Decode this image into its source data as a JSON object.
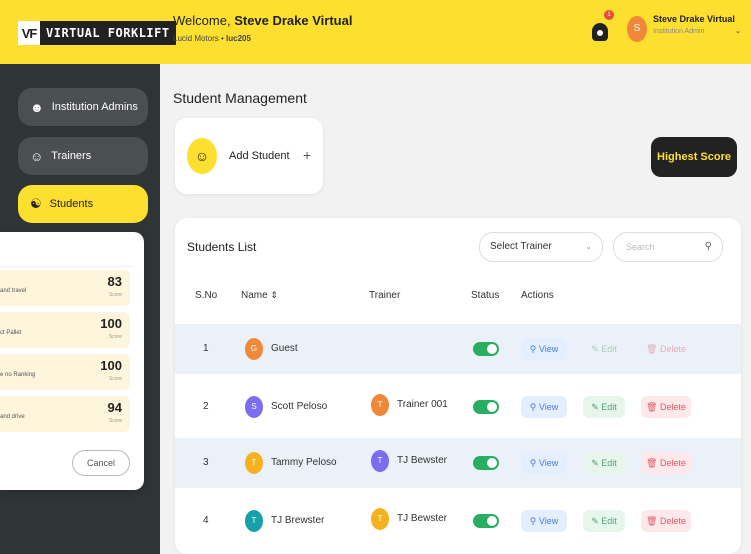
{
  "brand": {
    "logo_mark": "VF",
    "logo_text": "VIRTUAL FORKLIFT"
  },
  "header": {
    "welcome_prefix": "Welcome,",
    "user_full": "Steve Drake Virtual",
    "company": "Lucid Motors",
    "company_sep": " • ",
    "company_code": "luc205",
    "notification_count": "1",
    "avatar_initial": "S",
    "user_name": "Steve Drake Virtual",
    "user_role": "Institution Admin"
  },
  "sidebar": {
    "items": [
      {
        "label": "Institution Admins",
        "icon": "admin-icon"
      },
      {
        "label": "Trainers",
        "icon": "trainer-icon"
      },
      {
        "label": "Students",
        "icon": "student-icon",
        "active": true
      }
    ]
  },
  "main": {
    "title": "Student Management",
    "add_student_label": "Add Student",
    "add_plus": "+",
    "highest_score_label": "Highest Score"
  },
  "list": {
    "title": "Students List",
    "select_trainer": "Select Trainer",
    "search_placeholder": "Search",
    "columns": {
      "sno": "S.No",
      "name": "Name",
      "trainer": "Trainer",
      "status": "Status",
      "actions": "Actions"
    },
    "actions": {
      "view": "View",
      "edit": "Edit",
      "delete": "Delete"
    },
    "rows": [
      {
        "sno": "1",
        "initial": "G",
        "name": "Guest",
        "trainer_initial": "",
        "trainer": "",
        "active": true
      },
      {
        "sno": "2",
        "initial": "S",
        "name": "Scott Peloso",
        "trainer_initial": "T",
        "trainer": "Trainer 001",
        "active": true
      },
      {
        "sno": "3",
        "initial": "T",
        "name": "Tammy Peloso",
        "trainer_initial": "T",
        "trainer": "TJ Bewster",
        "active": true
      },
      {
        "sno": "4",
        "initial": "T",
        "name": "TJ Brewster",
        "trainer_initial": "T",
        "trainer": "TJ Bewster",
        "active": true
      }
    ]
  },
  "popup": {
    "scores": [
      {
        "label": "and travel",
        "value": "83",
        "caption": "Score"
      },
      {
        "label": "ct Pallet",
        "value": "100",
        "caption": "Score"
      },
      {
        "label": "e no Ranking",
        "value": "100",
        "caption": "Score"
      },
      {
        "label": "and drive",
        "value": "94",
        "caption": "Score"
      }
    ],
    "cancel_label": "Cancel"
  },
  "colors": {
    "brand_yellow": "#fde02f",
    "sidebar_dark": "#2f3437",
    "status_green": "#27ae60",
    "avatar_colors": [
      "#f0883a",
      "#7b6cf0",
      "#f5b21f",
      "#16a0a8"
    ]
  }
}
